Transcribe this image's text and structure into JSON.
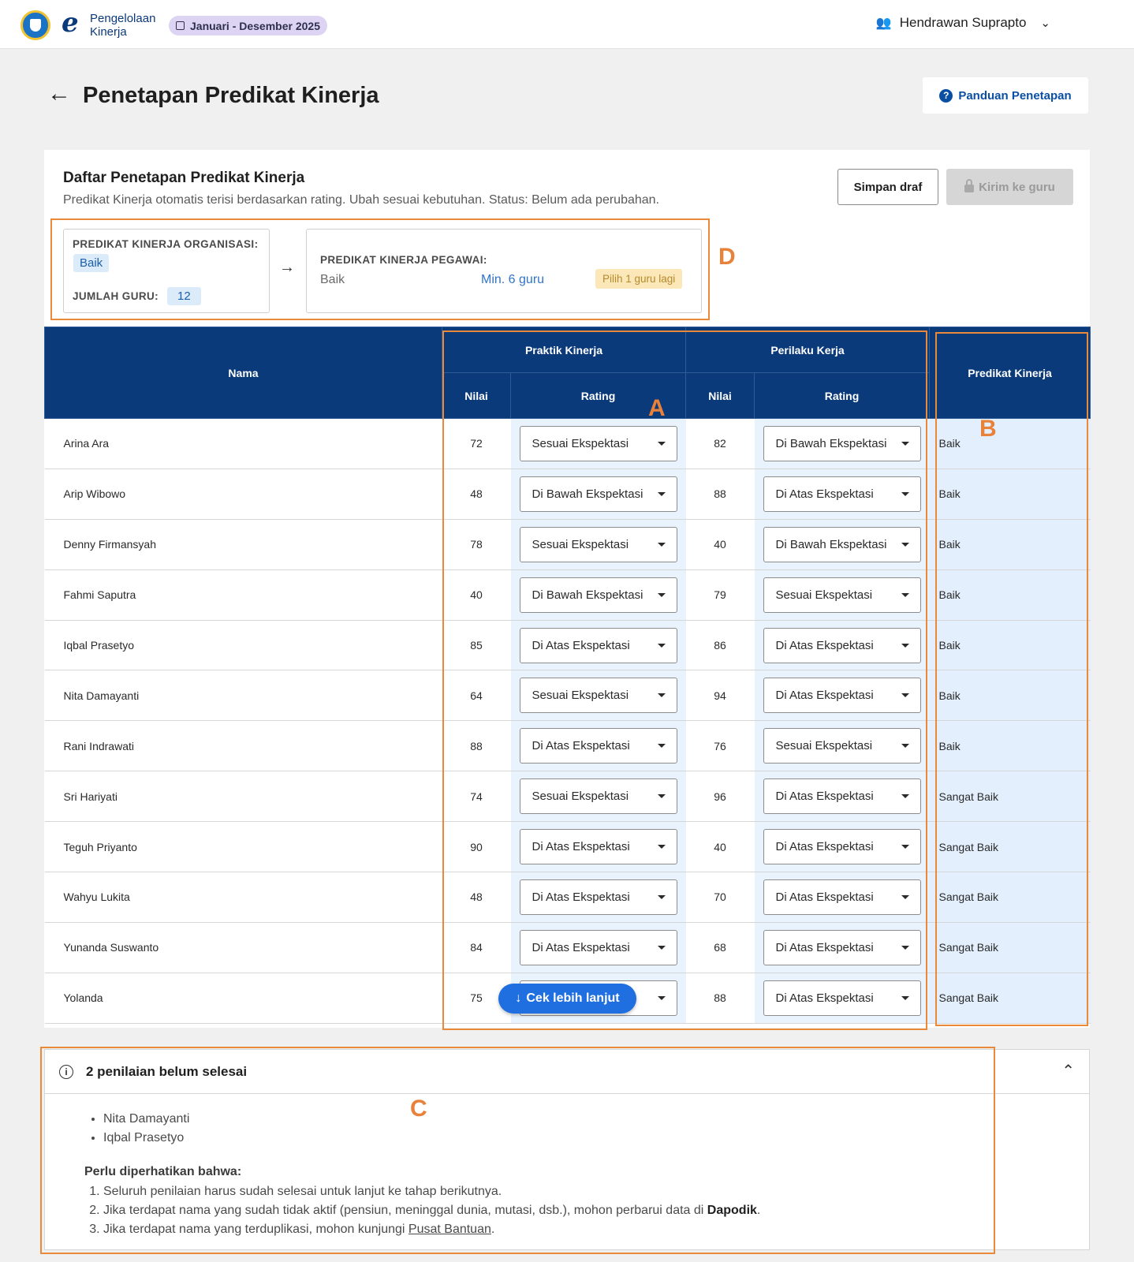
{
  "header": {
    "app_name_line1": "Pengelolaan",
    "app_name_line2": "Kinerja",
    "period": "Januari - Desember 2025",
    "user_name": "Hendrawan Suprapto"
  },
  "page": {
    "title": "Penetapan Predikat Kinerja",
    "guide_button": "Panduan Penetapan"
  },
  "card": {
    "title": "Daftar Penetapan Predikat Kinerja",
    "subtitle": "Predikat Kinerja otomatis terisi berdasarkan rating. Ubah sesuai kebutuhan. Status: Belum ada perubahan.",
    "save_draft": "Simpan draf",
    "send": "Kirim ke guru"
  },
  "summary": {
    "org_label": "PREDIKAT KINERJA ORGANISASI:",
    "org_value": "Baik",
    "count_label": "JUMLAH GURU:",
    "count_value": "12",
    "emp_label": "PREDIKAT KINERJA PEGAWAI:",
    "emp_value": "Baik",
    "emp_min": "Min. 6 guru",
    "emp_warning": "Pilih 1 guru lagi"
  },
  "table": {
    "col_name": "Nama",
    "group_practice": "Praktik Kinerja",
    "group_behavior": "Perilaku Kerja",
    "col_score": "Nilai",
    "col_rating": "Rating",
    "col_predicate": "Predikat Kinerja",
    "rows": [
      {
        "name": "Arina Ara",
        "p_score": "72",
        "p_rating": "Sesuai Ekspektasi",
        "b_score": "82",
        "b_rating": "Di Bawah Ekspektasi",
        "predicate": "Baik"
      },
      {
        "name": "Arip Wibowo",
        "p_score": "48",
        "p_rating": "Di Bawah Ekspektasi",
        "b_score": "88",
        "b_rating": "Di Atas Ekspektasi",
        "predicate": "Baik"
      },
      {
        "name": "Denny Firmansyah",
        "p_score": "78",
        "p_rating": "Sesuai Ekspektasi",
        "b_score": "40",
        "b_rating": "Di Bawah Ekspektasi",
        "predicate": "Baik"
      },
      {
        "name": "Fahmi Saputra",
        "p_score": "40",
        "p_rating": "Di Bawah Ekspektasi",
        "b_score": "79",
        "b_rating": "Sesuai Ekspektasi",
        "predicate": "Baik"
      },
      {
        "name": "Iqbal Prasetyo",
        "p_score": "85",
        "p_rating": "Di Atas Ekspektasi",
        "b_score": "86",
        "b_rating": "Di Atas Ekspektasi",
        "predicate": "Baik"
      },
      {
        "name": "Nita Damayanti",
        "p_score": "64",
        "p_rating": "Sesuai Ekspektasi",
        "b_score": "94",
        "b_rating": "Di Atas Ekspektasi",
        "predicate": "Baik"
      },
      {
        "name": "Rani Indrawati",
        "p_score": "88",
        "p_rating": "Di Atas Ekspektasi",
        "b_score": "76",
        "b_rating": "Sesuai Ekspektasi",
        "predicate": "Baik"
      },
      {
        "name": "Sri Hariyati",
        "p_score": "74",
        "p_rating": "Sesuai Ekspektasi",
        "b_score": "96",
        "b_rating": "Di Atas Ekspektasi",
        "predicate": "Sangat Baik"
      },
      {
        "name": "Teguh Priyanto",
        "p_score": "90",
        "p_rating": "Di Atas Ekspektasi",
        "b_score": "40",
        "b_rating": "Di Atas Ekspektasi",
        "predicate": "Sangat Baik"
      },
      {
        "name": "Wahyu Lukita",
        "p_score": "48",
        "p_rating": "Di Atas Ekspektasi",
        "b_score": "70",
        "b_rating": "Di Atas Ekspektasi",
        "predicate": "Sangat Baik"
      },
      {
        "name": "Yunanda Suswanto",
        "p_score": "84",
        "p_rating": "Di Atas Ekspektasi",
        "b_score": "68",
        "b_rating": "Di Atas Ekspektasi",
        "predicate": "Sangat Baik"
      },
      {
        "name": "Yolanda",
        "p_score": "75",
        "p_rating": "",
        "b_score": "88",
        "b_rating": "Di Atas Ekspektasi",
        "predicate": "Sangat Baik"
      }
    ]
  },
  "floating_button": "Cek lebih lanjut",
  "pending": {
    "title": "2 penilaian belum selesai",
    "names": [
      "Nita Damayanti",
      "Iqbal Prasetyo"
    ],
    "note_title": "Perlu diperhatikan bahwa:",
    "note_1": "Seluruh penilaian harus sudah selesai untuk lanjut ke tahap berikutnya.",
    "note_2_prefix": "Jika terdapat nama yang sudah tidak aktif (pensiun, meninggal dunia, mutasi, dsb.), mohon perbarui data di ",
    "note_2_bold": "Dapodik",
    "note_2_suffix": ".",
    "note_3_prefix": "Jika terdapat nama yang terduplikasi, mohon kunjungi ",
    "note_3_link": "Pusat Bantuan",
    "note_3_suffix": "."
  },
  "annotations": {
    "a": "A",
    "b": "B",
    "c": "C",
    "d": "D",
    "color": "#e88a3a"
  },
  "colors": {
    "header_blue": "#0b3a7a",
    "rating_bg": "#e8f3fd",
    "accent_button": "#1f6fe0"
  }
}
